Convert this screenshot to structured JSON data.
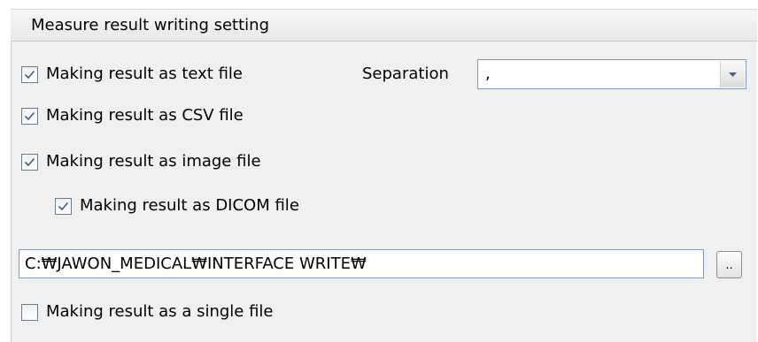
{
  "group": {
    "title": "Measure result writing setting"
  },
  "options": {
    "text_file": {
      "label": "Making result as text file",
      "checked": true
    },
    "csv_file": {
      "label": "Making result as CSV file",
      "checked": true
    },
    "image_file": {
      "label": "Making result as image file",
      "checked": true
    },
    "dicom_file": {
      "label": "Making result as DICOM file",
      "checked": true
    },
    "single_file": {
      "label": "Making result as a single file",
      "checked": false
    }
  },
  "separation": {
    "label": "Separation",
    "value": ","
  },
  "output_path": {
    "value": "C:₩JAWON_MEDICAL₩INTERFACE WRITE₩"
  },
  "browse_button": {
    "label": ".."
  },
  "colors": {
    "panel_bg": "#f0f0f0",
    "border_blue": "#7f9db9",
    "check_mark": "#3d5a82"
  },
  "icons": {
    "check": "check-icon",
    "dropdown": "chevron-down-icon"
  }
}
